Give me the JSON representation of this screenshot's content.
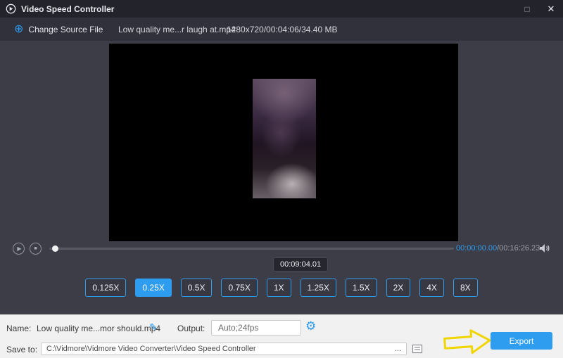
{
  "window": {
    "title": "Video Speed Controller",
    "controls": {
      "maximize": "□",
      "close": "✕"
    }
  },
  "toolbar": {
    "change_source_label": "Change Source File",
    "plus_icon": "⊕",
    "file_name": "Low quality me...r laugh at.mp4",
    "file_info": "1280x720/00:04:06/34.40 MB"
  },
  "player": {
    "play_icon": "▶",
    "stop_icon": "■",
    "time_current": "00:00:00.00",
    "time_total": "/00:16:26.23",
    "tooltip_time": "00:09:04.01",
    "progress_percent": 1
  },
  "speeds": {
    "options": [
      "0.125X",
      "0.25X",
      "0.5X",
      "0.75X",
      "1X",
      "1.25X",
      "1.5X",
      "2X",
      "4X",
      "8X"
    ],
    "selected": "0.25X"
  },
  "footer": {
    "name_label": "Name:",
    "name_value": "Low quality me...mor should.mp4",
    "edit_icon": "✎",
    "output_label": "Output:",
    "output_value": "Auto;24fps",
    "gear_icon": "⚙",
    "export_label": "Export",
    "save_to_label": "Save to:",
    "save_to_value": "C:\\Vidmore\\Vidmore Video Converter\\Video Speed Controller",
    "more_button": "..."
  },
  "colors": {
    "accent": "#2e9cef",
    "titlebar": "#23232b",
    "toolbar": "#31313b",
    "main_bg": "#3d3d47",
    "footer_bg": "#f1f1f1",
    "annotation_yellow": "#f0d500"
  }
}
